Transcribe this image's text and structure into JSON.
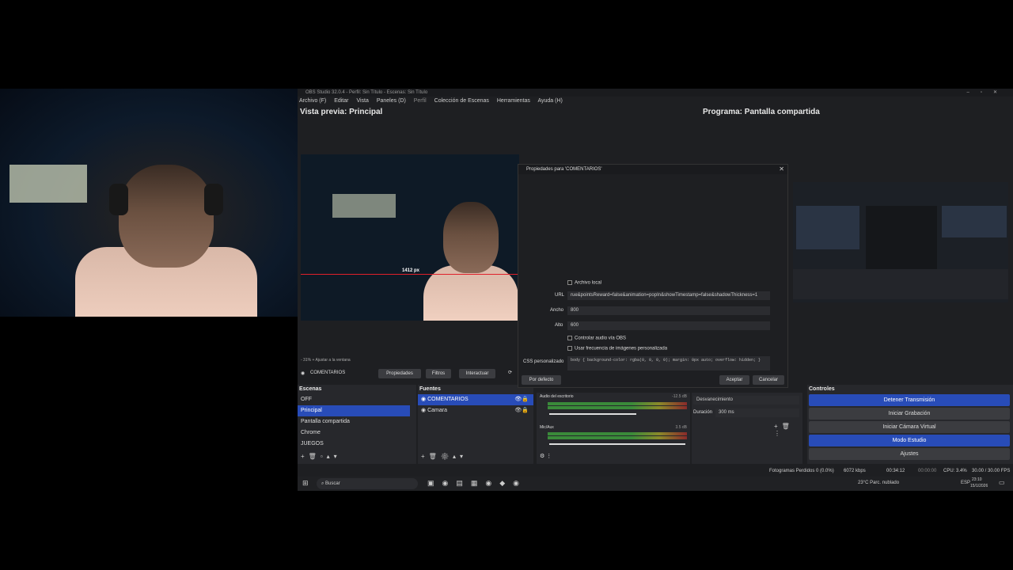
{
  "app": {
    "title": "OBS Studio 32.0.4 - Perfil: Sin Título - Escenas: Sin Título"
  },
  "menu": [
    "Archivo (F)",
    "Editar",
    "Vista",
    "Paneles (D)",
    "Perfil",
    "Colección de Escenas",
    "Herramientas",
    "Ayuda (H)"
  ],
  "preview_label": "Vista previa: Principal",
  "program_label": "Programa: Pantalla compartida",
  "measure_label": "1412 px",
  "zoom_text": "- 31% + Ajustar a la ventana",
  "source_bar": {
    "name": "COMENTARIOS",
    "props": "Propiedades",
    "filters": "Filtros",
    "interact": "Interactuar"
  },
  "dialog": {
    "title": "Propiedades para 'COMENTARIOS'",
    "local_file": "Archivo local",
    "url_label": "URL",
    "url_value": "rue&pointsReward=false&animation=popIn&showTimestamp=false&shadowThickness=1",
    "width_label": "Ancho",
    "width_value": "800",
    "height_label": "Alto",
    "height_value": "600",
    "audio_obs": "Controlar audio vía OBS",
    "custom_fps": "Usar frecuencia de imágenes personalizada",
    "css_label": "CSS personalizado",
    "css_value": "body { background-color: rgba(0, 0, 0, 0); margin: 0px auto; overflow: hidden; }",
    "default_btn": "Por defecto",
    "accept_btn": "Aceptar",
    "cancel_btn": "Cancelar"
  },
  "scenes": {
    "title": "Escenas",
    "items": [
      "OFF",
      "Principal",
      "Pantalla compartida",
      "Chrome",
      "JUEGOS"
    ],
    "selected": 1
  },
  "sources": {
    "title": "Fuentes",
    "items": [
      "COMENTARIOS",
      "Camara"
    ],
    "selected": 0
  },
  "mixer": {
    "track1": "Audio del escritorio",
    "track1_db": "-12.5 dB",
    "track2": "Mic/Aux",
    "track2_db": "3.5 dB",
    "track1_level": 0.72,
    "track2_level": 0.55
  },
  "transitions": {
    "type": "Desvanecimiento",
    "duration_label": "Duración",
    "duration_value": "300 ms"
  },
  "controls": {
    "title": "Controles",
    "stop_stream": "Detener Transmisión",
    "start_rec": "Iniciar Grabación",
    "virtual_cam": "Iniciar Cámara Virtual",
    "studio_mode": "Modo Estudio",
    "settings": "Ajustes"
  },
  "status": {
    "dropped": "Fotogramas Perdidos 0 (0.0%)",
    "kbps": "6072 kbps",
    "live": "00:34:12",
    "rec": "00:00:00",
    "cpu": "CPU: 3.4%",
    "fps": "30.00 / 30.00 FPS"
  },
  "taskbar": {
    "search": "Buscar",
    "weather": "23°C Parc. nublado",
    "lang": "ESP",
    "time": "23:10",
    "date": "15/1/2026"
  },
  "colors": {
    "accent": "#284cb8",
    "live_red": "#e0202a"
  }
}
